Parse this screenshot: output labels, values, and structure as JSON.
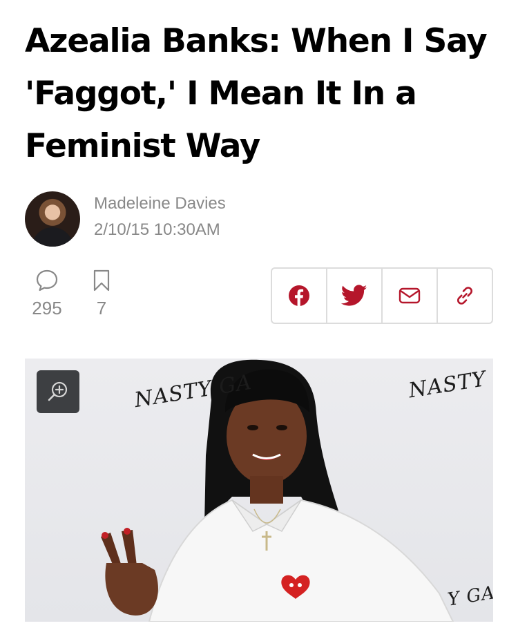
{
  "article": {
    "headline": "Azealia Banks: When I Say 'Faggot,' I Mean It In a Feminist Way",
    "author": "Madeleine Davies",
    "timestamp": "2/10/15 10:30AM"
  },
  "stats": {
    "comments": "295",
    "saves": "7"
  },
  "share": {
    "items": [
      "facebook-icon",
      "twitter-icon",
      "email-icon",
      "link-icon"
    ]
  },
  "hero": {
    "watermark_1": "NASTY GA",
    "watermark_2": "NASTY G",
    "watermark_3": "Y GAL"
  },
  "colors": {
    "accent": "#b5162b",
    "muted_text": "#888888",
    "border": "#dcdcdc"
  }
}
